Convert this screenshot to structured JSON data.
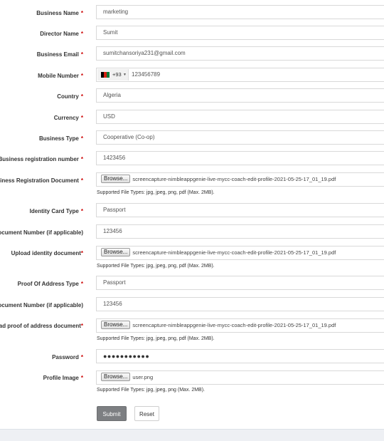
{
  "form": {
    "business_name": {
      "label": "Business Name",
      "required": "*",
      "value": "marketing"
    },
    "director_name": {
      "label": "Director Name",
      "required": "*",
      "value": "Sumit"
    },
    "business_email": {
      "label": "Business Email",
      "required": "*",
      "value": "sumitchansoriya231@gmail.com"
    },
    "mobile_number": {
      "label": "Mobile Number",
      "required": "*",
      "dial_code": "+93",
      "value": "123456789",
      "flag_colors": [
        "#000000",
        "#d32011",
        "#007a36"
      ]
    },
    "country": {
      "label": "Country",
      "required": "*",
      "value": "Algeria"
    },
    "currency": {
      "label": "Currency",
      "required": "*",
      "value": "USD"
    },
    "business_type": {
      "label": "Business Type",
      "required": "*",
      "value": "Cooperative (Co-op)"
    },
    "business_reg_number": {
      "label": "Business registration number",
      "required": "*",
      "value": "1423456"
    },
    "business_reg_document": {
      "label": "Business Registration Document",
      "required": "*",
      "browse": "Browse...",
      "file": "screencapture-nimbleappgenie-live-mycc-coach-edit-profile-2021-05-25-17_01_19.pdf",
      "hint": "Supported File Types: jpg, jpeg, png, pdf (Max. 2MB)."
    },
    "identity_card_type": {
      "label": "Identity Card Type",
      "required": "*",
      "value": "Passport"
    },
    "identity_doc_number": {
      "label": "Document Number (if applicable)",
      "value": "123456"
    },
    "identity_upload": {
      "label": "Upload identity document",
      "required": "*",
      "browse": "Browse...",
      "file": "screencapture-nimbleappgenie-live-mycc-coach-edit-profile-2021-05-25-17_01_19.pdf",
      "hint": "Supported File Types: jpg, jpeg, png, pdf (Max. 2MB)."
    },
    "proof_address_type": {
      "label": "Proof Of Address Type",
      "required": "*",
      "value": "Passport"
    },
    "address_doc_number": {
      "label": "Document Number (if applicable)",
      "value": "123456"
    },
    "address_upload": {
      "label": "Upload proof of address document",
      "required": "*",
      "browse": "Browse...",
      "file": "screencapture-nimbleappgenie-live-mycc-coach-edit-profile-2021-05-25-17_01_19.pdf",
      "hint": "Supported File Types: jpg, jpeg, png, pdf (Max. 2MB)."
    },
    "password": {
      "label": "Password",
      "required": "*",
      "value": "●●●●●●●●●●●"
    },
    "profile_image": {
      "label": "Profile Image",
      "required": "*",
      "browse": "Browse...",
      "file": "user.png",
      "hint": "Supported File Types: jpg, jpeg, png (Max. 2MB)."
    }
  },
  "actions": {
    "submit": "Submit",
    "reset": "Reset"
  }
}
